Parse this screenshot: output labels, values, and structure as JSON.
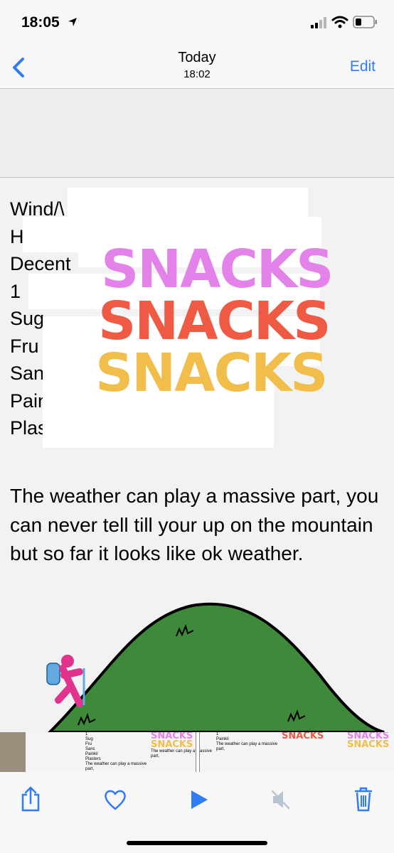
{
  "status_bar": {
    "time": "18:05"
  },
  "nav": {
    "title": "Today",
    "subtitle": "18:02",
    "edit_label": "Edit"
  },
  "photo": {
    "list_items": [
      "Wind/\\",
      "Ha",
      "Decent",
      "1",
      "Sug",
      "Fru",
      "Sanc",
      "Painkil",
      "Plasters"
    ],
    "snacks_text": [
      "SNACKS",
      "SNACKS",
      "SNACKS"
    ],
    "paragraph": "The weather can play a massive part, you can never tell till your up on the mountain but so far it looks like ok weather."
  },
  "filmstrip": {
    "thumb_lines": [
      "1",
      "Sug",
      "Fru",
      "Sanc",
      "Painkil",
      "Plasters"
    ],
    "thumb_snack": "SNACKS",
    "thumb_para": "The weather can play a massive part,"
  },
  "colors": {
    "accent": "#2f7cf6",
    "snack_pink": "#e382e8",
    "snack_red": "#ef5a45",
    "snack_yellow": "#f2be4b",
    "hill_green": "#3f8a3a",
    "hiker_pink": "#e0338e",
    "backpack_blue": "#62a9e0"
  },
  "icons": [
    "location-arrow-icon",
    "signal-icon",
    "wifi-icon",
    "battery-icon",
    "back-chevron-icon",
    "share-icon",
    "heart-icon",
    "play-icon",
    "mute-icon",
    "trash-icon"
  ]
}
